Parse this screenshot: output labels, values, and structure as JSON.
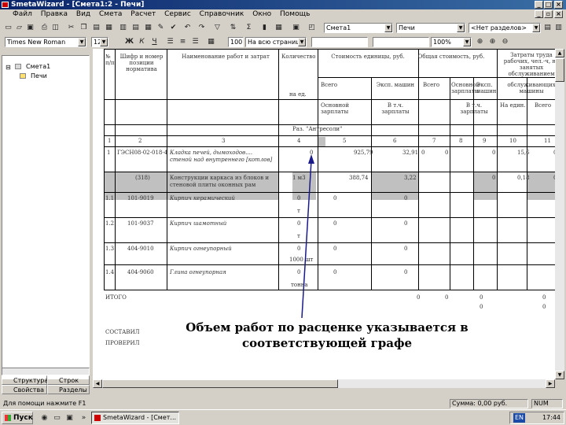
{
  "window": {
    "title": "SmetaWizard - [Смета1:2 - Печи]"
  },
  "menu": [
    "Файл",
    "Правка",
    "Вид",
    "Смета",
    "Расчет",
    "Сервис",
    "Справочник",
    "Окно",
    "Помощь"
  ],
  "toolbar1": {
    "estimate_combo": "Смета1",
    "section_combo": "Печи",
    "subsection_combo": "<Нет разделов>"
  },
  "toolbar2": {
    "font_combo": "Times New Roman",
    "size_combo": "12",
    "bold": "Ж",
    "italic": "К",
    "underline": "Ч",
    "row_number": "100",
    "page_combo": "На всю страницу",
    "zoom_combo": "100%"
  },
  "tree": {
    "root": "Смета1",
    "child": "Печи"
  },
  "left_tabs": [
    {
      "label": "Структура"
    },
    {
      "label": "Строк"
    },
    {
      "label": "Свойства"
    },
    {
      "label": "Разделы"
    }
  ],
  "table": {
    "headers": {
      "num": "№ п/п",
      "code": "Шифр и номер позиции норматива",
      "name": "Наименование работ и затрат",
      "qty": "Количество",
      "unit_cost": "Стоимость единицы, руб.",
      "total_cost": "Общая стоимость, руб.",
      "labor": "Затраты труда рабочих, чел.-ч, не занятых обслуживанием",
      "total": "Всего",
      "wages_machine": "Эксп. машин",
      "total2": "Всего",
      "base_wages": "Основной зарплаты",
      "wages_machine2": "Эксп. машин",
      "machine_service": "обслуживающих машины",
      "per_unit": "на ед.",
      "base_pay": "Основной зарплаты",
      "incl_pay": "В т.ч. зарплаты",
      "incl_pay2": "В т.ч. зарплаты",
      "per_unit2": "На един.",
      "total3": "Всего",
      "section_title": "Раз. \"Антресоли\""
    },
    "col_numbers": [
      "1",
      "2",
      "3",
      "4",
      "5",
      "6",
      "7",
      "8",
      "9",
      "10",
      "11"
    ],
    "rows": [
      {
        "num": "1",
        "code": "ГЭСН08-02-018-4",
        "name": "Кладка печей, дымоходов.... ",
        "name2": "стеной над внутреннего [котлов]",
        "qty": "0",
        "c5": "925,79",
        "c6": "32,91",
        "c7": "0",
        "c8": "0",
        "c9": "0",
        "c10": "15,6",
        "c11": "0"
      },
      {
        "num": "",
        "code": "(318)",
        "name": "Конструкции каркаса из блоков и",
        "name2": "стеновой плиты оконных рам",
        "qty": "1 м3",
        "c5": "388,74",
        "c6": "3,22",
        "c7": "",
        "c8": "",
        "c9": "0",
        "c10": "0,18",
        "c11": "0"
      },
      {
        "num": "1.1",
        "code": "101-9019",
        "name": "Кирпич керамический",
        "name2": "",
        "qty": "0",
        "unit": "т",
        "c5": "0",
        "c6": "",
        "c7": "0"
      },
      {
        "num": "1.2",
        "code": "101-9037",
        "name": "Кирпич шамотный",
        "name2": "",
        "qty": "0",
        "unit": "т",
        "c5": "0",
        "c6": "",
        "c7": "0"
      },
      {
        "num": "1.3",
        "code": "404-9010",
        "name": "Кирпич огнеупорный",
        "name2": "",
        "qty": "0",
        "unit": "1000 шт",
        "c5": "0",
        "c6": "",
        "c7": "0"
      },
      {
        "num": "1.4",
        "code": "404-9060",
        "name": "Глина огнеупорная",
        "name2": "",
        "qty": "0",
        "unit": "тонна",
        "c5": "0",
        "c6": "",
        "c7": "0"
      }
    ],
    "itogo": "ИТОГО",
    "itogo_values": [
      "0",
      "0",
      "0",
      "0",
      "0",
      "0"
    ],
    "sostavil": "СОСТАВИЛ",
    "proveril": "ПРОВЕРИЛ"
  },
  "annotation": {
    "line1": "Объем работ по расценке указывается в",
    "line2": "соответствующей графе"
  },
  "status": {
    "hint": "Для помощи нажмите F1",
    "sum": "Сумма: 0,00 руб.",
    "mode": "NUM"
  },
  "taskbar": {
    "start": "Пуск",
    "app": "SmetaWizard - [Смет...",
    "lang": "EN",
    "time": "17:44"
  }
}
